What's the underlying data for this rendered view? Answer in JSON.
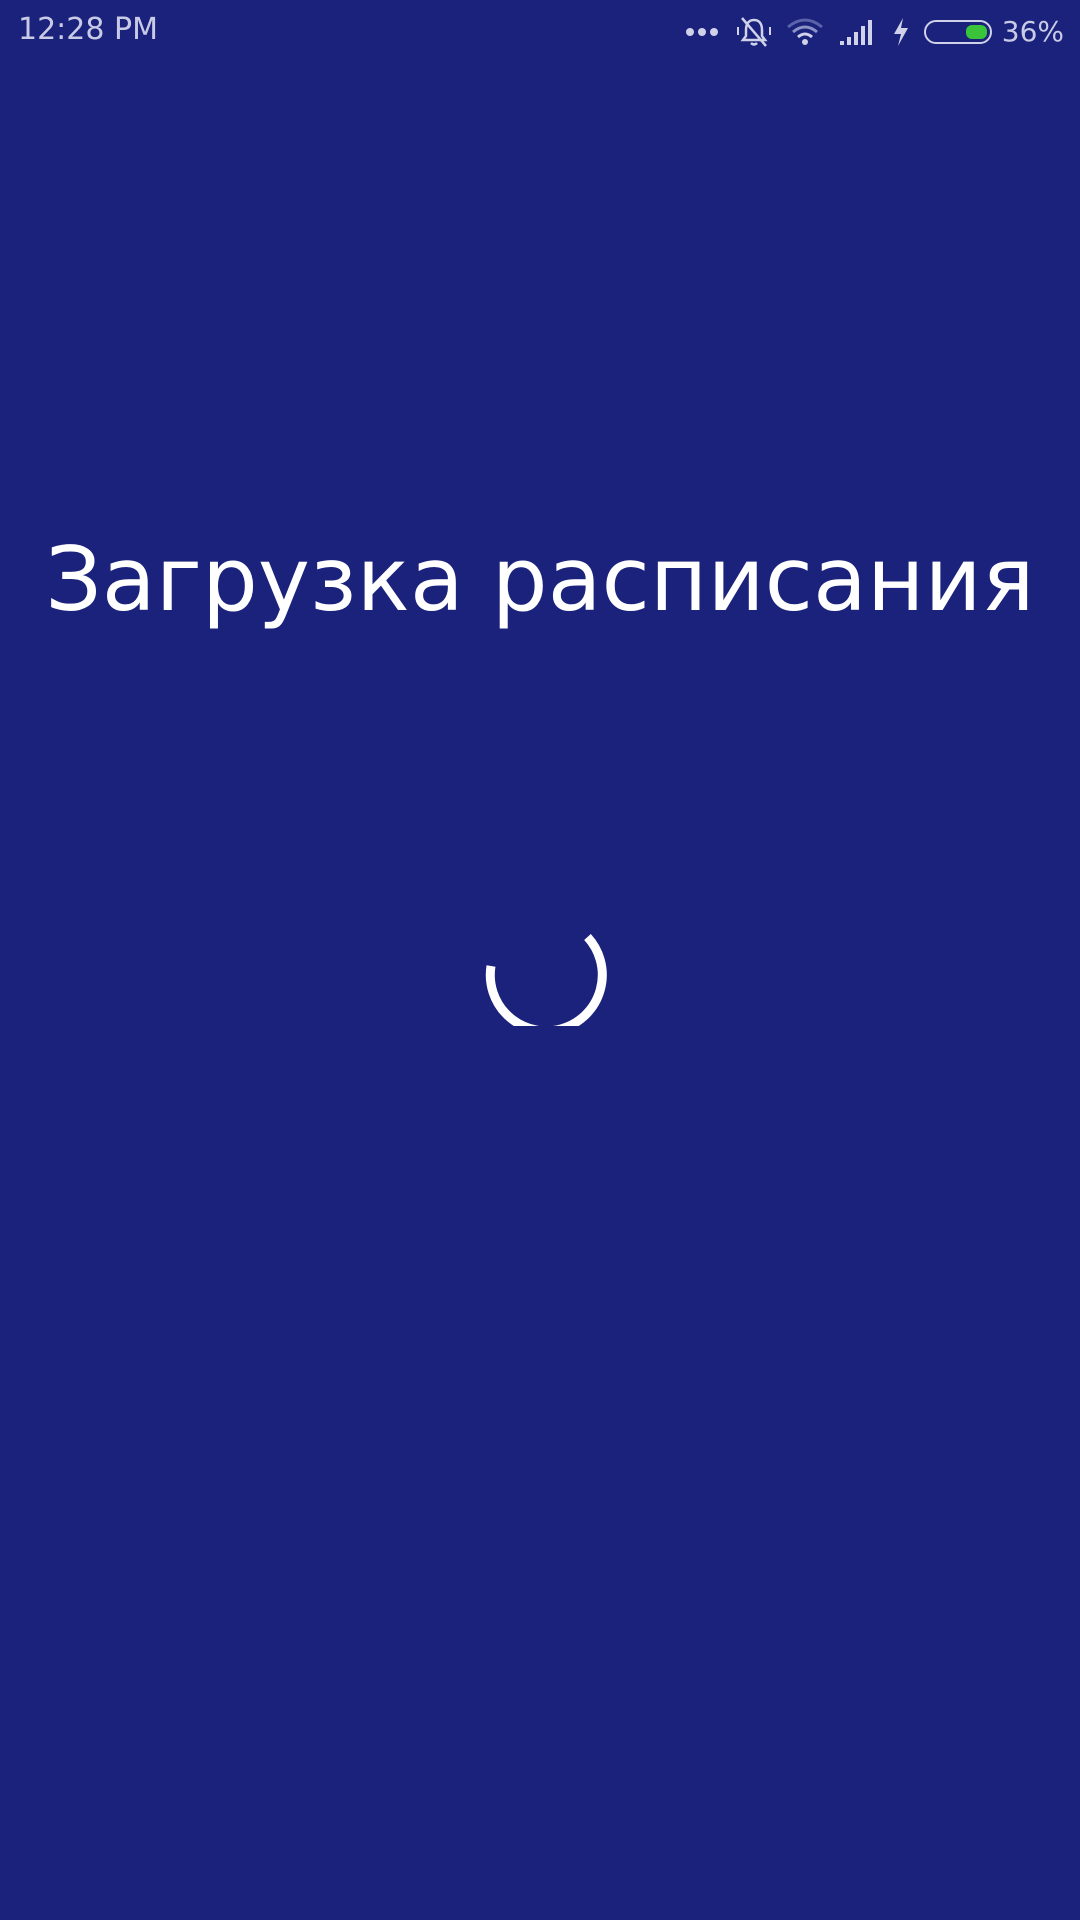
{
  "status_bar": {
    "time": "12:28 PM",
    "battery_percent": "36%",
    "battery_level": 0.36,
    "battery_fill_color": "#3ac43a",
    "icons": [
      "more-dots-icon",
      "vibrate-silent-icon",
      "wifi-icon",
      "signal-icon",
      "charging-icon",
      "battery-icon"
    ]
  },
  "main": {
    "title": "Загрузка расписания",
    "background_color": "#1a227c",
    "spinner": "loading-spinner-icon"
  }
}
